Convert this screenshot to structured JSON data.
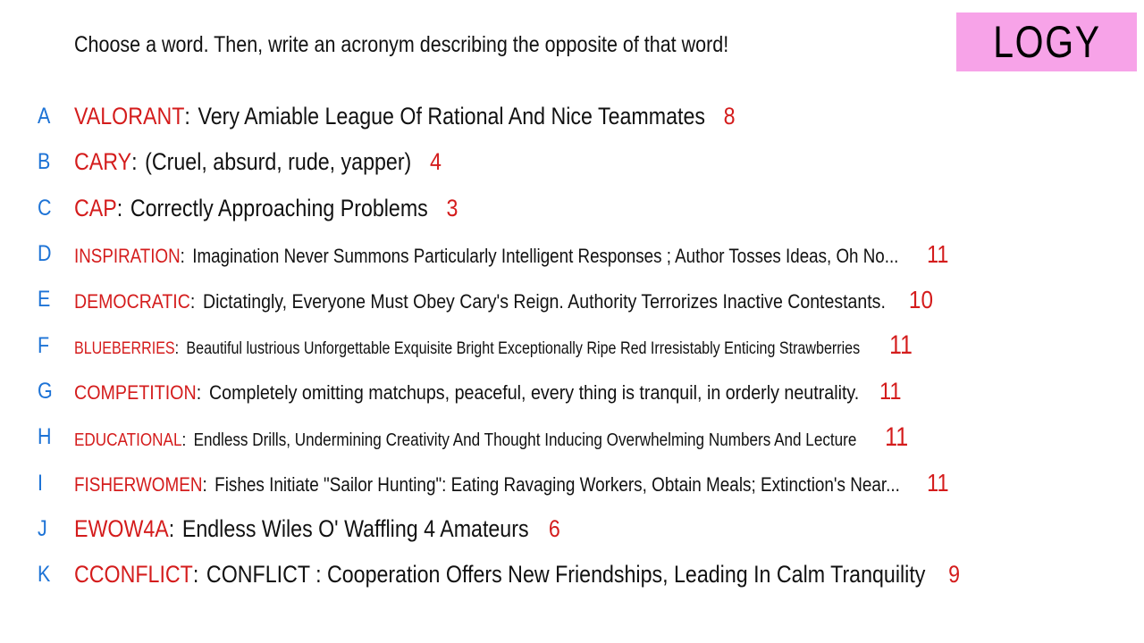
{
  "prompt": "Choose a word. Then, write an acronym describing the opposite of that word!",
  "logo": "LOGY",
  "colors": {
    "letter": "#1d73d6",
    "word": "#d41c1c",
    "text": "#111111",
    "logo_bg": "#f7a3e8"
  },
  "rows": [
    {
      "letter": "A",
      "word": "VALORANT",
      "acronym": "Very Amiable League Of Rational And Nice Teammates",
      "count": "8"
    },
    {
      "letter": "B",
      "word": "CARY",
      "acronym": "(Cruel, absurd, rude, yapper)",
      "count": "4"
    },
    {
      "letter": "C",
      "word": "CAP",
      "acronym": "Correctly Approaching Problems",
      "count": "3"
    },
    {
      "letter": "D",
      "word": "INSPIRATION",
      "acronym": "Imagination Never Summons Particularly Intelligent Responses ; Author Tosses Ideas, Oh No...",
      "count": "11"
    },
    {
      "letter": "E",
      "word": "DEMOCRATIC",
      "acronym": "Dictatingly, Everyone Must Obey Cary's Reign. Authority Terrorizes Inactive Contestants.",
      "count": "10"
    },
    {
      "letter": "F",
      "word": "BLUEBERRIES",
      "acronym": "Beautiful lustrious Unforgettable Exquisite Bright Exceptionally Ripe Red Irresistably Enticing Strawberries",
      "count": "11"
    },
    {
      "letter": "G",
      "word": "COMPETITION",
      "acronym": "Completely omitting matchups, peaceful, every thing is tranquil, in orderly neutrality.",
      "count": "11"
    },
    {
      "letter": "H",
      "word": "EDUCATIONAL",
      "acronym": "Endless Drills, Undermining Creativity And Thought Inducing Overwhelming Numbers And Lecture",
      "count": "11"
    },
    {
      "letter": "I",
      "word": "FISHERWOMEN",
      "acronym": "Fishes Initiate \"Sailor Hunting\": Eating Ravaging Workers, Obtain Meals; Extinction's Near...",
      "count": "11"
    },
    {
      "letter": "J",
      "word": "EWOW4A",
      "acronym": "Endless Wiles O' Waffling 4 Amateurs",
      "count": "6"
    },
    {
      "letter": "K",
      "word": "CCONFLICT",
      "acronym": "CONFLICT : Cooperation Offers New Friendships, Leading In Calm Tranquility",
      "count": "9"
    }
  ]
}
